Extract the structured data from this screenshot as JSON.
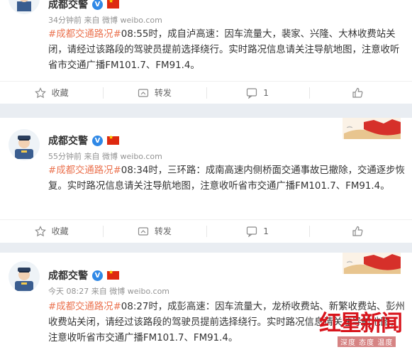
{
  "posts": [
    {
      "name": "成都交警",
      "time": "34分钟前",
      "source": "来自 微博 weibo.com",
      "hashtag": "#成都交通路况#",
      "content": "08:55时，成自泸高速：因车流量大，裴家、兴隆、大林收费站关闭，请经过该路段的驾驶员提前选择绕行。实时路况信息请关注导航地图，注意收听省市交通广播FM101.7、FM91.4。",
      "actions": {
        "collect": "收藏",
        "forward": "转发",
        "comment": "1",
        "like": ""
      }
    },
    {
      "name": "成都交警",
      "time": "55分钟前",
      "source": "来自 微博 weibo.com",
      "hashtag": "#成都交通路况#",
      "content": "08:34时，三环路：成南高速内侧桥面交通事故已撤除，交通逐步恢复。实时路况信息请关注导航地图，注意收听省市交通广播FM101.7、FM91.4。",
      "actions": {
        "collect": "收藏",
        "forward": "转发",
        "comment": "1",
        "like": ""
      }
    },
    {
      "name": "成都交警",
      "time": "今天 08:27",
      "source": "来自 微博 weibo.com",
      "hashtag": "#成都交通路况#",
      "content": "08:27时，成彭高速：因车流量大，龙桥收费站、新繁收费站、彭州收费站关闭，请经过该路段的驾驶员提前选择绕行。实时路况信息请关注导航地图，注意收听省市交通广播FM101.7、FM91.4。"
    }
  ],
  "verified_mark": "V",
  "watermark": {
    "title": "红星新闻",
    "subtitle": "深度 态度 温度"
  },
  "colors": {
    "hashtag": "#eb7350",
    "verified": "#2f88e6",
    "brand_red": "#d8141c"
  },
  "icons": [
    "collect-icon",
    "forward-icon",
    "comment-icon",
    "like-icon"
  ]
}
